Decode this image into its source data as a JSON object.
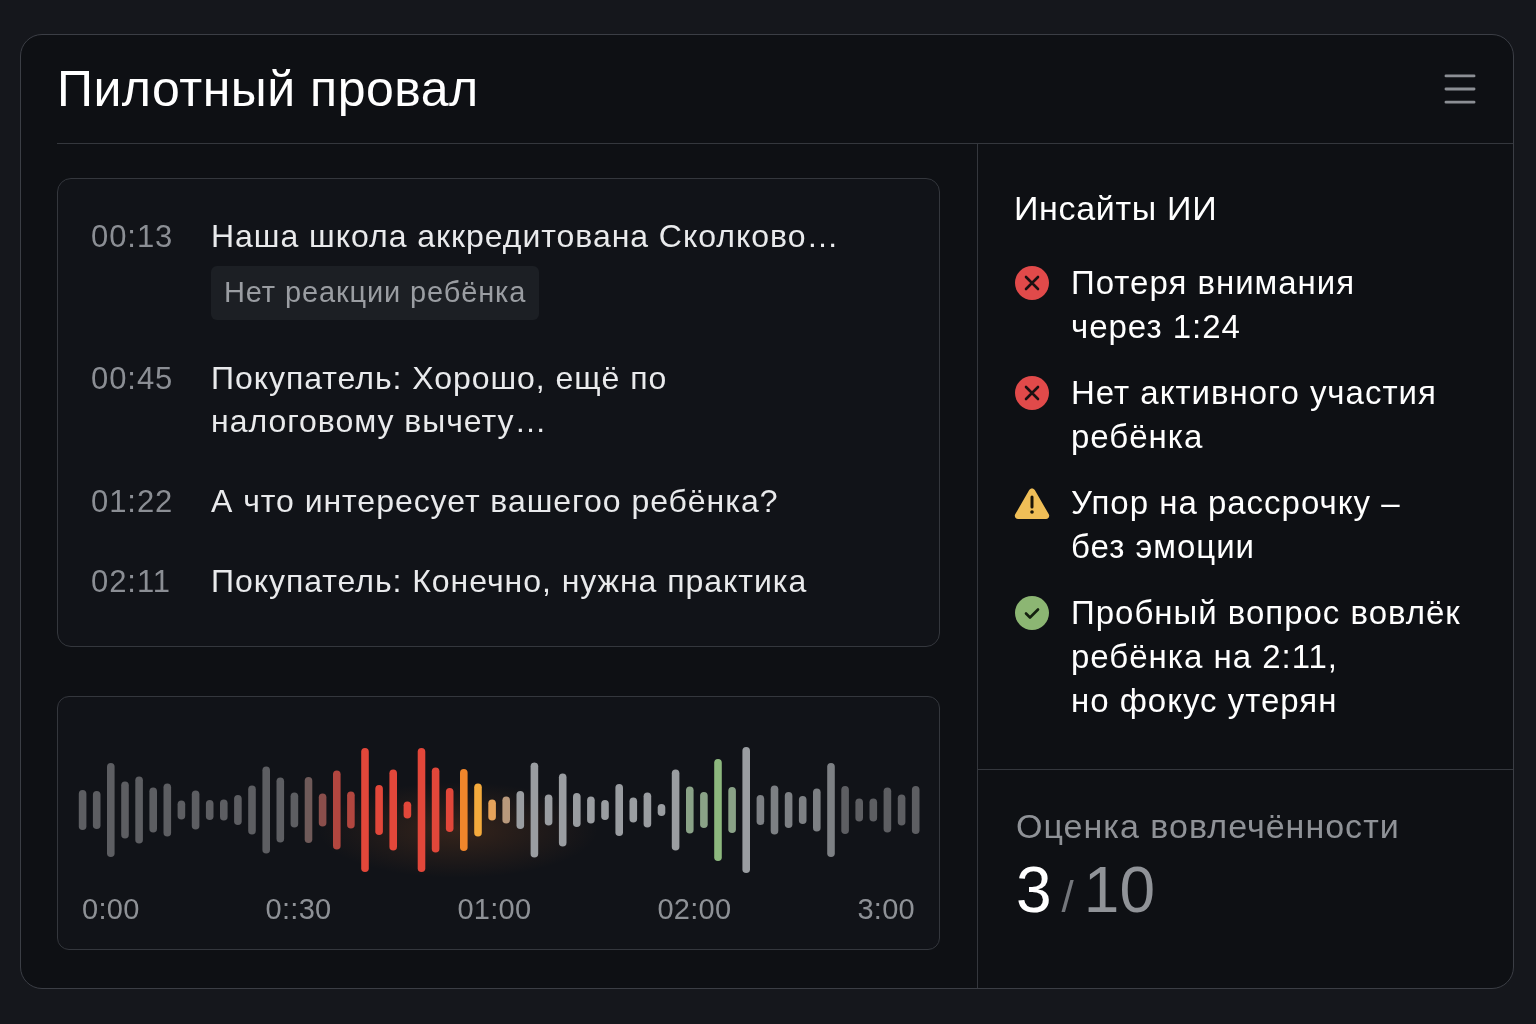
{
  "header": {
    "title": "Пилотный провал"
  },
  "transcript": [
    {
      "time": "00:13",
      "text": "Наша школа аккредитована Сколково…",
      "tag": "Нет реакции ребёнка"
    },
    {
      "time": "00:45",
      "text": "Покупатель: Хорошо, ещё по\nналоговому вычету…"
    },
    {
      "time": "01:22",
      "text": "А что интересует вашегоо ребёнка?"
    },
    {
      "time": "02:11",
      "text": "Покупатель: Конечно, нужна практика"
    }
  ],
  "waveform": {
    "time_labels": [
      "0:00",
      "0::30",
      "01:00",
      "02:00",
      "3:00"
    ]
  },
  "insights": {
    "title": "Инсайты ИИ",
    "items": [
      {
        "kind": "negative",
        "text": "Потеря внимания\nчерез 1:24"
      },
      {
        "kind": "negative",
        "text": "Нет активного участия\nребёнка"
      },
      {
        "kind": "warning",
        "text": "Упор на рассрочку –\nбез эмоции"
      },
      {
        "kind": "positive",
        "text": "Пробный вопрос вовлёк\nребёнка на 2:11,\nно фокус утерян"
      }
    ]
  },
  "score": {
    "label": "Оценка вовлечённости",
    "value": "3",
    "separator": "/",
    "max": "10"
  }
}
